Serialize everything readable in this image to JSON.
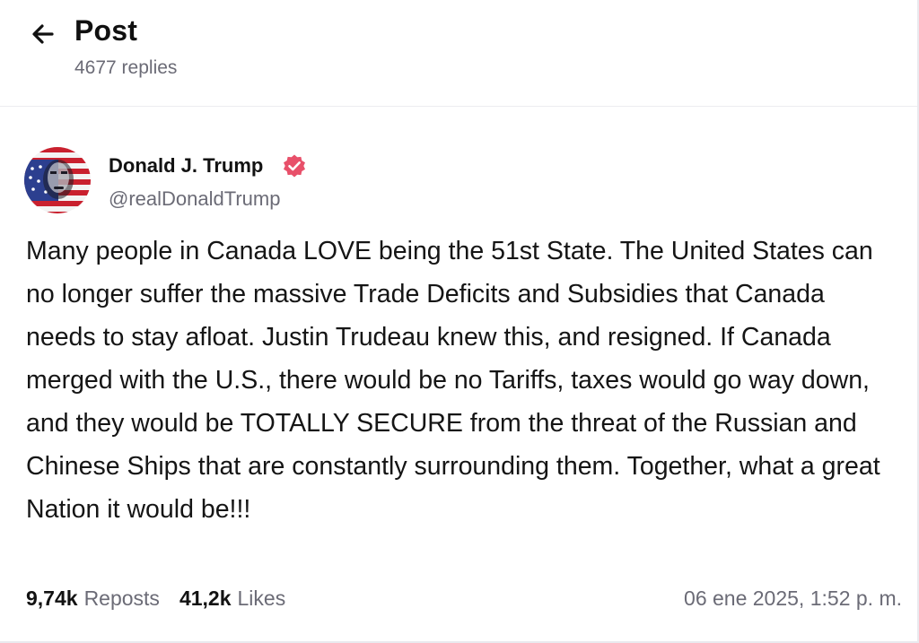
{
  "header": {
    "title": "Post",
    "replies": "4677 replies"
  },
  "post": {
    "author_name": "Donald J. Trump",
    "author_handle": "@realDonaldTrump",
    "verified": true,
    "body": "Many people in Canada LOVE being the 51st State. The United States can no longer suffer the massive Trade Deficits and Subsidies that Canada needs to stay afloat. Justin Trudeau knew this, and resigned. If Canada merged with the U.S., there would be no Tariffs, taxes would go way down, and they would be TOTALLY SECURE from the threat of the Russian and Chinese Ships that are constantly surrounding them. Together, what a great Nation it would be!!!",
    "reposts_count": "9,74k",
    "reposts_label": "Reposts",
    "likes_count": "41,2k",
    "likes_label": "Likes",
    "timestamp": "06 ene 2025, 1:52 p. m."
  },
  "icons": {
    "back": "arrow-left-icon",
    "verified": "verified-badge-icon",
    "avatar": "avatar"
  },
  "colors": {
    "text_primary": "#111111",
    "text_secondary": "#6b6b76",
    "verified_badge": "#e8506a",
    "divider": "#ececf0"
  }
}
